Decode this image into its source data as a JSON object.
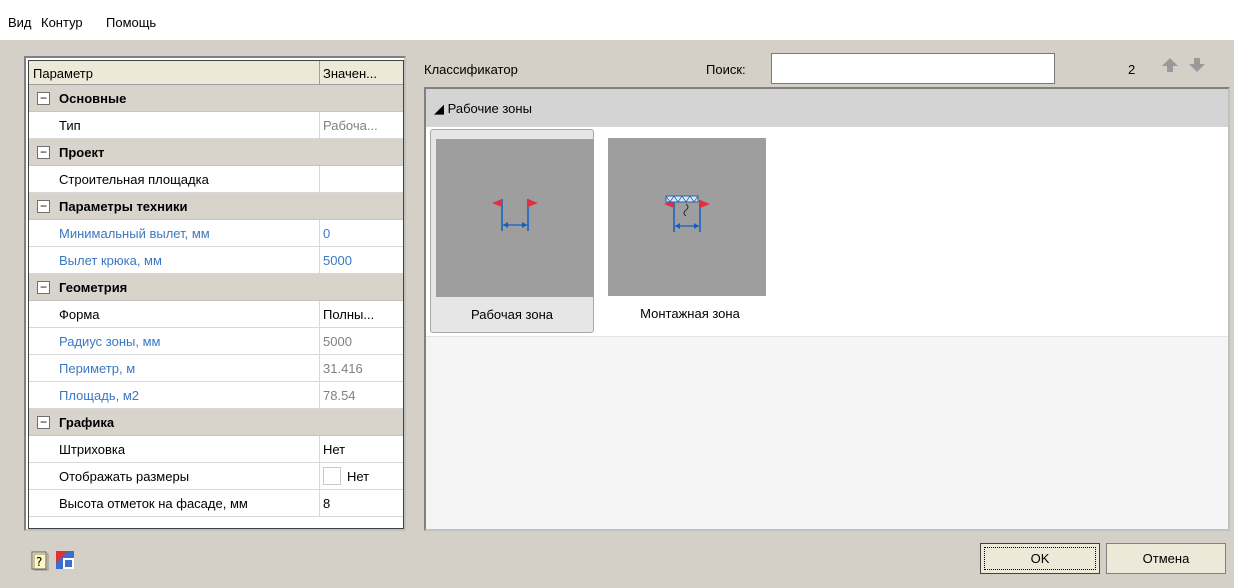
{
  "menu": [
    "Вид",
    "Контур",
    "Помощь"
  ],
  "property_grid": {
    "col_param": "Параметр",
    "col_value": "Значен...",
    "rows": [
      {
        "type": "category",
        "name": "Основные"
      },
      {
        "type": "prop",
        "name": "Тип",
        "value": "Рабоча...",
        "name_style": "normal",
        "value_style": "gray"
      },
      {
        "type": "category",
        "name": "Проект"
      },
      {
        "type": "prop",
        "name": "Строительная площадка",
        "value": "",
        "name_style": "normal",
        "value_style": "normal"
      },
      {
        "type": "category",
        "name": "Параметры техники"
      },
      {
        "type": "prop",
        "name": "Минимальный вылет, мм",
        "value": "0",
        "name_style": "blue",
        "value_style": "blue"
      },
      {
        "type": "prop",
        "name": "Вылет крюка, мм",
        "value": "5000",
        "name_style": "blue",
        "value_style": "blue"
      },
      {
        "type": "category",
        "name": "Геометрия"
      },
      {
        "type": "prop",
        "name": "Форма",
        "value": "Полны...",
        "name_style": "normal",
        "value_style": "normal"
      },
      {
        "type": "prop",
        "name": "Радиус зоны, мм",
        "value": "5000",
        "name_style": "blue",
        "value_style": "gray"
      },
      {
        "type": "prop",
        "name": "Периметр, м",
        "value": "31.416",
        "name_style": "blue",
        "value_style": "gray"
      },
      {
        "type": "prop",
        "name": "Площадь, м2",
        "value": "78.54",
        "name_style": "blue",
        "value_style": "gray"
      },
      {
        "type": "category",
        "name": "Графика"
      },
      {
        "type": "prop",
        "name": "Штриховка",
        "value": "Нет",
        "name_style": "normal",
        "value_style": "normal"
      },
      {
        "type": "prop",
        "name": "Отображать размеры",
        "value": "Нет",
        "name_style": "normal",
        "value_style": "normal",
        "checkbox": true
      },
      {
        "type": "prop",
        "name": "Высота отметок на фасаде, мм",
        "value": "8",
        "name_style": "normal",
        "value_style": "normal"
      }
    ],
    "toggle_glyph": "−"
  },
  "classifier": {
    "label": "Классификатор",
    "search_label": "Поиск:",
    "search_value": "",
    "count": "2",
    "group_title": "◢ Рабочие зоны",
    "items": [
      {
        "caption": "Рабочая зона",
        "selected": true,
        "icon": "work-zone-icon"
      },
      {
        "caption": "Монтажная зона",
        "selected": false,
        "icon": "mounting-zone-icon"
      }
    ]
  },
  "buttons": {
    "ok": "OK",
    "cancel": "Отмена"
  },
  "colors": {
    "blue_text": "#3b78c4",
    "gray_text": "#808080",
    "flag_red": "#e0303c",
    "dim_blue": "#1060c0"
  }
}
